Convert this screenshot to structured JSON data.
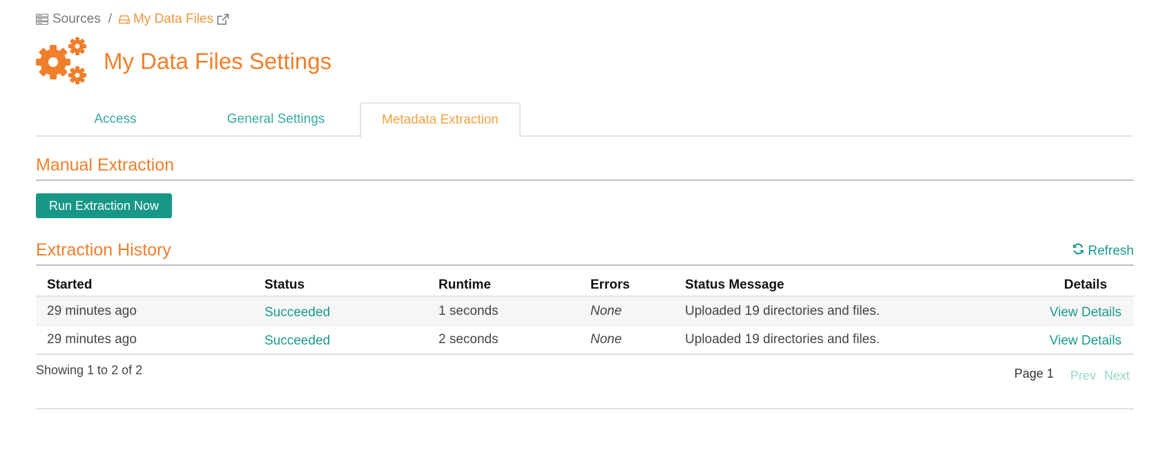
{
  "breadcrumb": {
    "root": "Sources",
    "separator": "/",
    "current": "My Data Files"
  },
  "page": {
    "title": "My Data Files Settings"
  },
  "tabs": [
    {
      "label": "Access",
      "active": false
    },
    {
      "label": "General Settings",
      "active": false
    },
    {
      "label": "Metadata Extraction",
      "active": true
    }
  ],
  "manual": {
    "heading": "Manual Extraction",
    "run_label": "Run Extraction Now"
  },
  "history": {
    "heading": "Extraction History",
    "refresh_label": "Refresh",
    "columns": [
      "Started",
      "Status",
      "Runtime",
      "Errors",
      "Status Message",
      "Details"
    ],
    "rows": [
      {
        "started": "29 minutes ago",
        "status": "Succeeded",
        "runtime": "1 seconds",
        "errors": "None",
        "message": "Uploaded 19 directories and files.",
        "details": "View Details"
      },
      {
        "started": "29 minutes ago",
        "status": "Succeeded",
        "runtime": "2 seconds",
        "errors": "None",
        "message": "Uploaded 19 directories and files.",
        "details": "View Details"
      }
    ],
    "showing": "Showing 1 to 2 of 2",
    "page_label": "Page 1",
    "prev_label": "Prev",
    "next_label": "Next"
  },
  "colors": {
    "accent_orange": "#f07f2b",
    "teal": "#179787",
    "link_teal": "#18998a",
    "tab_active": "#f0a23e"
  },
  "icons": {
    "sources": "server-icon",
    "drive": "drive-icon",
    "external": "external-link-icon",
    "title": "gears-icon",
    "refresh": "refresh-icon"
  }
}
